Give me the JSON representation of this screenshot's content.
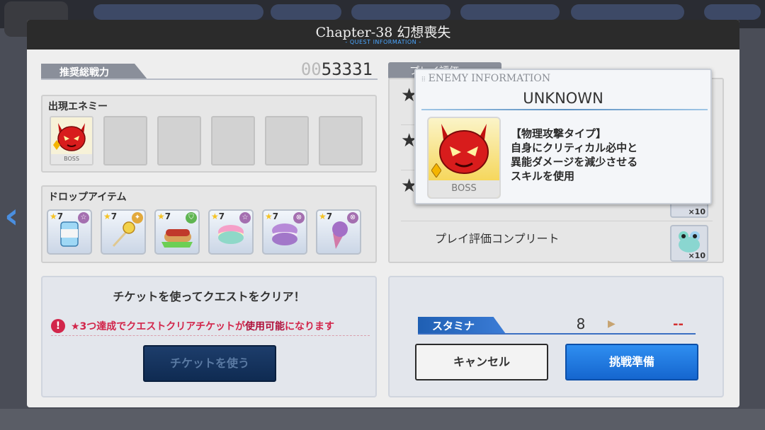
{
  "dialog": {
    "title": "Chapter-38 幻想喪失",
    "subtitle": "- QUEST INFORMATION -"
  },
  "recommended_power": {
    "label": "推奨総戦力",
    "value_prefix": "00",
    "value": "53331"
  },
  "enemies": {
    "title": "出現エネミー",
    "boss_tag": "BOSS",
    "empty_slots": 5
  },
  "drops": {
    "title": "ドロップアイテム",
    "items": [
      {
        "rarity": "7",
        "icon": "canned-drink-icon"
      },
      {
        "rarity": "7",
        "icon": "lollipop-icon"
      },
      {
        "rarity": "7",
        "icon": "hotdog-icon"
      },
      {
        "rarity": "7",
        "icon": "rainbow-macaron-icon"
      },
      {
        "rarity": "7",
        "icon": "purple-macaron-icon"
      },
      {
        "rarity": "7",
        "icon": "ice-cream-cone-icon"
      }
    ]
  },
  "ticket": {
    "heading": "チケットを使ってクエストをクリア！",
    "note_prefix": "★3つ達成でクエストクリアチケットが",
    "note_highlight": "使用可能",
    "note_suffix": "になります",
    "use_button": "チケットを使う"
  },
  "evaluation": {
    "tab_label": "プレイ評価",
    "complete_label": "プレイ評価コンプリート",
    "reward_count": "×10",
    "reward_icon": "frog-plush-icon"
  },
  "stamina": {
    "label": "スタミナ",
    "current": "8",
    "after": "--"
  },
  "buttons": {
    "cancel": "キャンセル",
    "prepare": "挑戦準備"
  },
  "enemy_info": {
    "header": "ENEMY INFORMATION",
    "name": "UNKNOWN",
    "boss_tag": "BOSS",
    "description_lines": [
      "【物理攻撃タイプ】",
      "自身にクリティカル必中と",
      "異能ダメージを減少させる",
      "スキルを使用"
    ]
  },
  "colors": {
    "accent_blue": "#1566cf",
    "alert_red": "#d2264b",
    "header_dark": "#2b2b2b"
  }
}
